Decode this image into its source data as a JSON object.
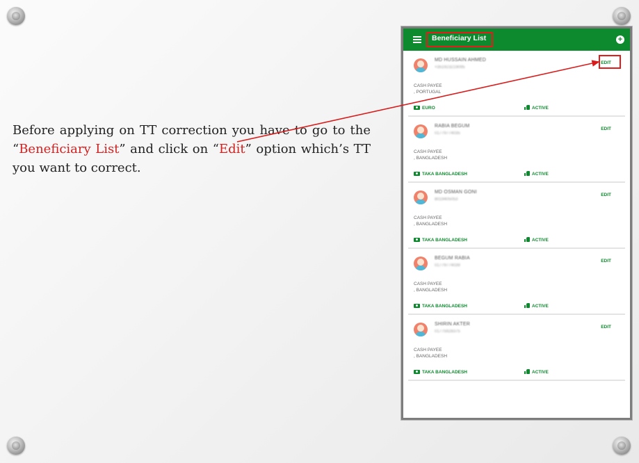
{
  "instruction": {
    "part1": "Before applying on TT correction you have to go to the “",
    "highlight1": "Beneficiary List",
    "part2": "” and click on “",
    "highlight2": "Edit",
    "part3": "” option which’s TT you want to correct."
  },
  "app": {
    "title": "Beneficiary List",
    "menu_icon": "menu-icon",
    "add_icon": "add-circle-icon",
    "accent_color": "#0e8a2e",
    "highlight_color": "#e21b1b"
  },
  "beneficiaries": [
    {
      "name": "MD HUSSAIN AHMED",
      "phone": "+351923219095",
      "payee_type": "CASH PAYEE",
      "country": ", PORTUGAL",
      "currency": "EURO",
      "status": "ACTIVE",
      "edit_label": "EDIT"
    },
    {
      "name": "RABIA BEGUM",
      "phone": "01779774035",
      "payee_type": "CASH PAYEE",
      "country": ", BANGLADESH",
      "currency": "TAKA BANGLADESH",
      "status": "ACTIVE",
      "edit_label": "EDIT"
    },
    {
      "name": "MD OSMAN GONI",
      "phone": "8019405053",
      "payee_type": "CASH PAYEE",
      "country": ", BANGLADESH",
      "currency": "TAKA BANGLADESH",
      "status": "ACTIVE",
      "edit_label": "EDIT"
    },
    {
      "name": "BEGUM RABIA",
      "phone": "01779774039",
      "payee_type": "CASH PAYEE",
      "country": ", BANGLADESH",
      "currency": "TAKA BANGLADESH",
      "status": "ACTIVE",
      "edit_label": "EDIT"
    },
    {
      "name": "SHIRIN AKTER",
      "phone": "01775928375",
      "payee_type": "CASH PAYEE",
      "country": ", BANGLADESH",
      "currency": "TAKA BANGLADESH",
      "status": "ACTIVE",
      "edit_label": "EDIT"
    }
  ]
}
